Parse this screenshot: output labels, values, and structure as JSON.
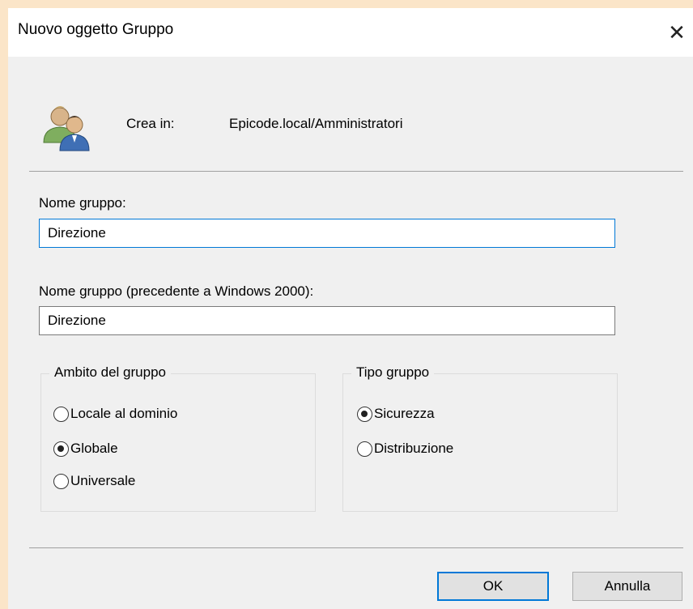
{
  "window": {
    "title": "Nuovo oggetto Gruppo",
    "close_icon": "close-icon"
  },
  "header": {
    "icon": "users-group-icon",
    "create_in_label": "Crea in:",
    "create_in_value": "Epicode.local/Amministratori"
  },
  "form": {
    "group_name_label": "Nome gruppo:",
    "group_name_value": "Direzione",
    "legacy_name_label": "Nome gruppo (precedente a Windows 2000):",
    "legacy_name_value": "Direzione"
  },
  "scope": {
    "legend": "Ambito del gruppo",
    "options": [
      {
        "label": "Locale al dominio",
        "checked": false
      },
      {
        "label": "Globale",
        "checked": true
      },
      {
        "label": "Universale",
        "checked": false
      }
    ]
  },
  "type": {
    "legend": "Tipo gruppo",
    "options": [
      {
        "label": "Sicurezza",
        "checked": true
      },
      {
        "label": "Distribuzione",
        "checked": false
      }
    ]
  },
  "buttons": {
    "ok_label": "OK",
    "cancel_label": "Annulla"
  },
  "colors": {
    "background": "#fbe5c8",
    "dialog_body": "#f0f0f0",
    "accent": "#0078d7"
  }
}
